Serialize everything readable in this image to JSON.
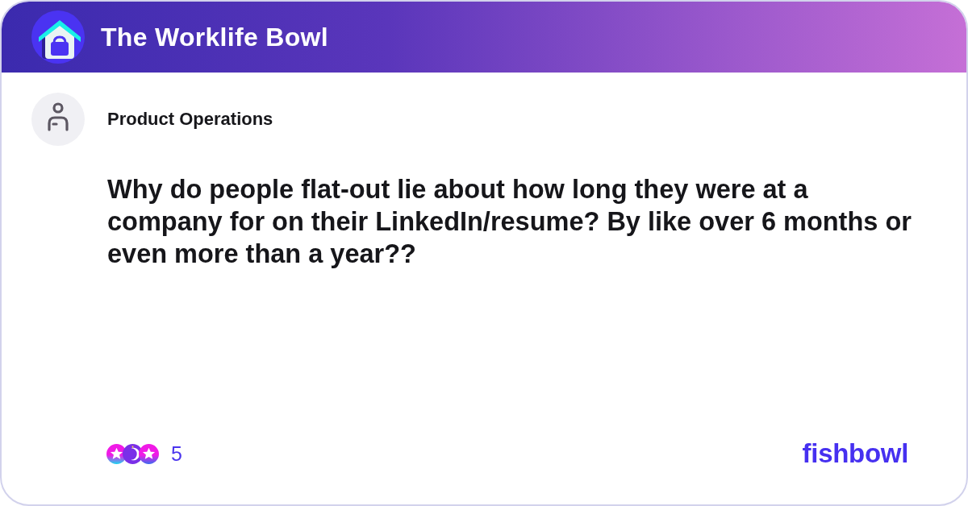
{
  "header": {
    "title": "The Worklife Bowl"
  },
  "post": {
    "author": "Product Operations",
    "text": "Why do people flat-out lie about how long they were at a company for on their LinkedIn/resume? By like over 6 months or even more than a year??"
  },
  "footer": {
    "reaction_count": "5",
    "brand": "fishbowl"
  }
}
